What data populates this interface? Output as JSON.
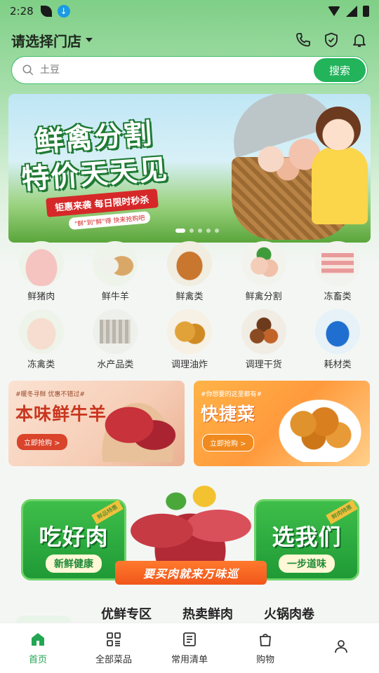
{
  "status": {
    "time": "2:28"
  },
  "header": {
    "store_select": "请选择门店"
  },
  "search": {
    "placeholder": "土豆",
    "button": "搜索"
  },
  "banner": {
    "title_line1": "鲜禽分割",
    "title_line2": "特价天天见",
    "ribbon": "钜惠来袭  每日限时秒杀",
    "sub": "\"鲜\"到\"鲜\"得 快来抢购吧"
  },
  "categories": [
    {
      "label": "鲜猪肉"
    },
    {
      "label": "鲜牛羊"
    },
    {
      "label": "鲜禽类"
    },
    {
      "label": "鲜禽分割"
    },
    {
      "label": "冻畜类"
    },
    {
      "label": "冻禽类"
    },
    {
      "label": "水产品类"
    },
    {
      "label": "调理油炸"
    },
    {
      "label": "调理干货"
    },
    {
      "label": "耗材类"
    }
  ],
  "promos": [
    {
      "tag": "#暖冬寻鲜 优惠不错过#",
      "title": "本味鲜牛羊",
      "button": "立即抢购 >"
    },
    {
      "tag": "#你想要的这里都有#",
      "title": "快捷菜",
      "button": "立即抢购 >"
    }
  ],
  "feature_banner": {
    "left_text": "吃好肉",
    "left_tag": "鲜品特惠",
    "left_sub": "新鲜健康",
    "right_text": "选我们",
    "right_tag": "鲜肉特惠",
    "right_sub": "一步道味",
    "slogan": "要买肉就来万味巡"
  },
  "zones": [
    "优鲜专区",
    "热卖鲜肉",
    "火锅肉卷"
  ],
  "tabbar": [
    {
      "label": "首页",
      "icon": "home-icon"
    },
    {
      "label": "全部菜品",
      "icon": "grid-icon"
    },
    {
      "label": "常用清单",
      "icon": "list-icon"
    },
    {
      "label": "购物",
      "icon": "cart-icon"
    },
    {
      "label": "",
      "icon": "user-icon"
    }
  ],
  "colors": {
    "accent": "#22b35b",
    "active_tab": "#22a652"
  }
}
